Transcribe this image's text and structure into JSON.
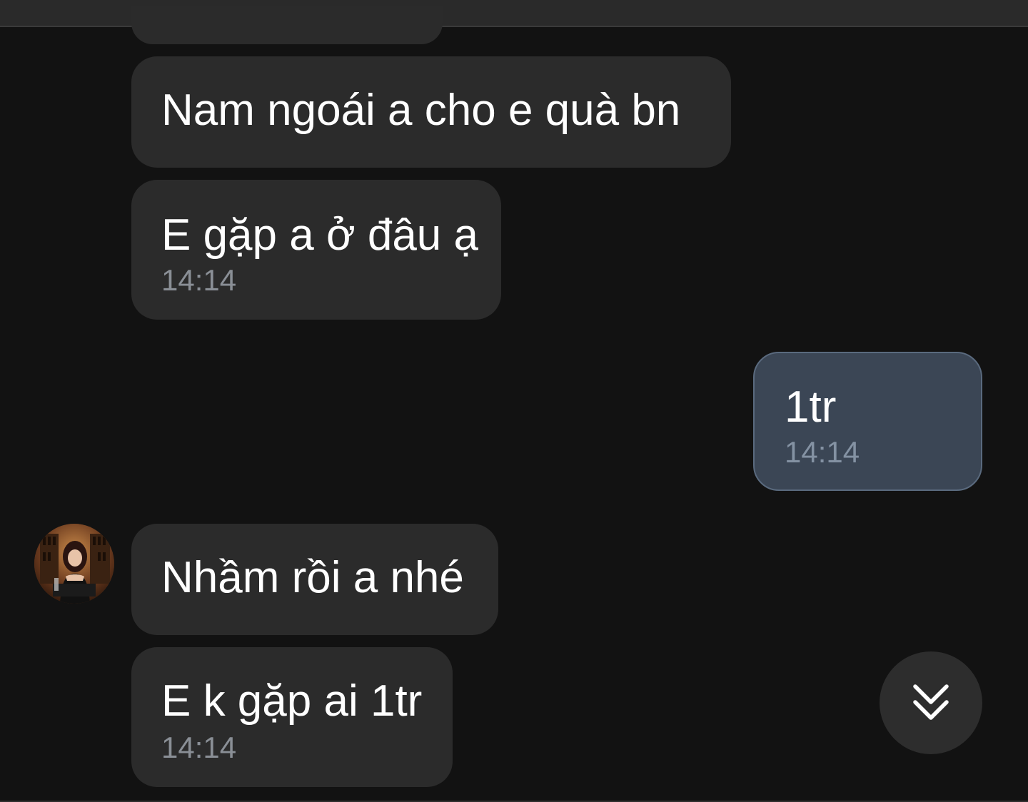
{
  "messages": [
    {
      "text": "Nam ngoái a cho e quà bn"
    },
    {
      "text": "E gặp a ở đâu ạ",
      "time": "14:14"
    },
    {
      "text": "1tr",
      "time": "14:14"
    },
    {
      "text": "Nhầm rồi a nhé"
    },
    {
      "text": "E k gặp ai 1tr",
      "time": "14:14"
    }
  ],
  "icons": {
    "avatar": "contact-avatar-photo",
    "scroll_down": "double-chevron-down-icon"
  },
  "colors": {
    "background": "#121212",
    "incoming_bubble": "#2b2b2b",
    "outgoing_bubble": "#3b4655",
    "timestamp": "#8a8f96"
  }
}
